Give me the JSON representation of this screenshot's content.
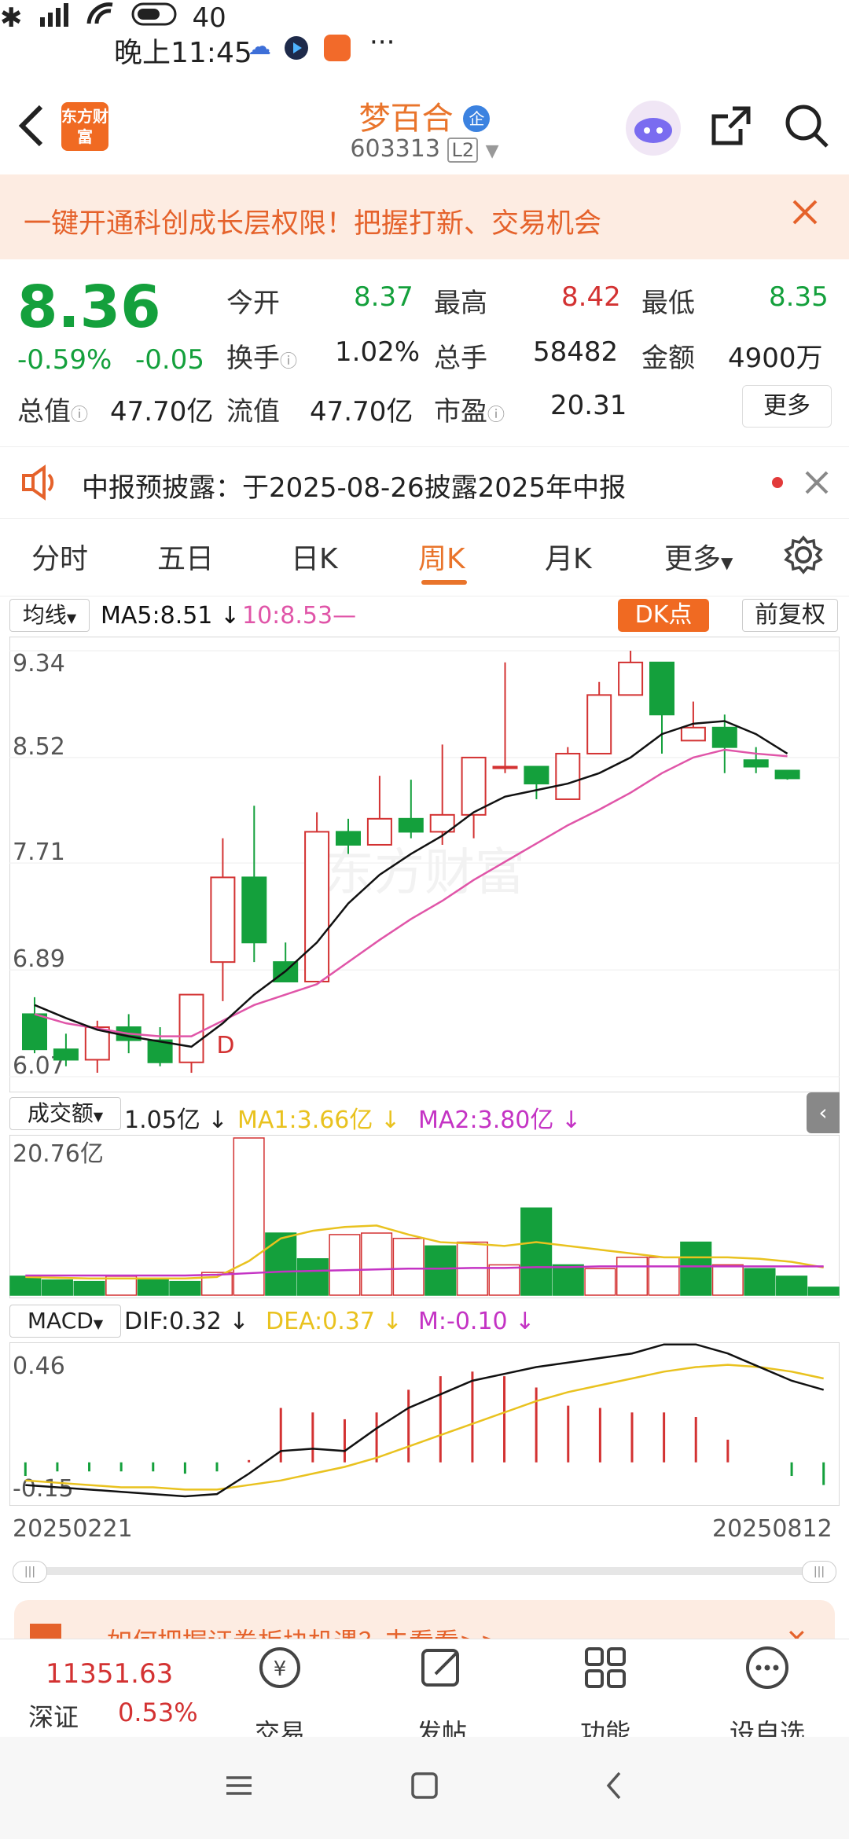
{
  "status_bar": {
    "time": "晚上11:45",
    "extra": "···",
    "battery": "40"
  },
  "header": {
    "logo_text": "东方财富",
    "title": "梦百合",
    "badge": "企",
    "code": "603313",
    "level": "L2"
  },
  "banner": {
    "text": "一键开通科创成长层权限！把握打新、交易机会"
  },
  "quote": {
    "price": "8.36",
    "change_pct": "-0.59%",
    "change": "-0.05",
    "rows": [
      [
        {
          "label": "今开",
          "value": "8.37",
          "color": "green"
        },
        {
          "label": "最高",
          "value": "8.42",
          "color": "red"
        },
        {
          "label": "最低",
          "value": "8.35",
          "color": "green"
        }
      ],
      [
        {
          "label": "换手",
          "value": "1.02%",
          "color": "dark"
        },
        {
          "label": "总手",
          "value": "58482",
          "color": "dark"
        },
        {
          "label": "金额",
          "value": "4900万",
          "color": "dark"
        }
      ],
      [
        {
          "label": "总值",
          "value": "47.70亿",
          "color": "dark"
        },
        {
          "label": "流值",
          "value": "47.70亿",
          "color": "dark"
        },
        {
          "label": "市盈",
          "value": "20.31",
          "color": "dark"
        }
      ]
    ],
    "more_label": "更多"
  },
  "notice": {
    "text": "中报预披露：于2025-08-26披露2025年中报"
  },
  "tabs": [
    "分时",
    "五日",
    "日K",
    "周K",
    "月K",
    "更多"
  ],
  "active_tab": "周K",
  "kline": {
    "ma_selector": "均线",
    "ma5_label": "MA5:8.51",
    "ma10_label": "10:8.53",
    "dk_label": "DK点",
    "adjust_label": "前复权",
    "y_ticks": [
      "9.34",
      "8.52",
      "7.71",
      "6.89",
      "6.07"
    ],
    "d_marker": "D",
    "watermark": "东方财富"
  },
  "volume": {
    "selector": "成交额",
    "current": "1.05亿",
    "ma1_label": "MA1:3.66亿",
    "ma2_label": "MA2:3.80亿",
    "max_label": "20.76亿"
  },
  "macd": {
    "selector": "MACD",
    "dif_label": "DIF:0.32",
    "dea_label": "DEA:0.37",
    "m_label": "M:-0.10",
    "top_tick": "0.46",
    "bottom_tick": "-0.15"
  },
  "x_axis": {
    "start": "20250221",
    "end": "20250812"
  },
  "promo": {
    "text": "如何把握证券板块机遇？去看看>>"
  },
  "bottom_nav": {
    "index_value": "11351.63",
    "index_name": "深证",
    "index_change": "0.53%",
    "items": [
      "交易",
      "发帖",
      "功能",
      "设自选"
    ]
  },
  "colors": {
    "up": "#d33232",
    "down": "#14a03c",
    "accent": "#e9742b",
    "ma5": "#111111",
    "ma10": "#e055a8",
    "ma1": "#e9c21f",
    "ma2": "#c433c4"
  },
  "chart_data": {
    "type": "candlestick",
    "period": "weekly",
    "x_start": "20250221",
    "x_end": "20250812",
    "ylim": [
      6.07,
      9.34
    ],
    "candles": [
      {
        "o": 6.55,
        "h": 6.68,
        "l": 6.25,
        "c": 6.28
      },
      {
        "o": 6.28,
        "h": 6.4,
        "l": 6.15,
        "c": 6.2
      },
      {
        "o": 6.2,
        "h": 6.5,
        "l": 6.1,
        "c": 6.45
      },
      {
        "o": 6.45,
        "h": 6.55,
        "l": 6.25,
        "c": 6.35
      },
      {
        "o": 6.35,
        "h": 6.45,
        "l": 6.15,
        "c": 6.18
      },
      {
        "o": 6.18,
        "h": 6.7,
        "l": 6.1,
        "c": 6.7
      },
      {
        "o": 6.95,
        "h": 7.9,
        "l": 6.65,
        "c": 7.6
      },
      {
        "o": 7.6,
        "h": 8.15,
        "l": 6.95,
        "c": 7.1
      },
      {
        "o": 6.95,
        "h": 7.1,
        "l": 6.8,
        "c": 6.8
      },
      {
        "o": 6.8,
        "h": 8.1,
        "l": 6.8,
        "c": 7.95
      },
      {
        "o": 7.95,
        "h": 8.05,
        "l": 7.78,
        "c": 7.85
      },
      {
        "o": 7.85,
        "h": 8.38,
        "l": 7.85,
        "c": 8.05
      },
      {
        "o": 8.05,
        "h": 8.35,
        "l": 7.9,
        "c": 7.95
      },
      {
        "o": 7.95,
        "h": 8.62,
        "l": 7.85,
        "c": 8.08
      },
      {
        "o": 8.08,
        "h": 8.5,
        "l": 7.9,
        "c": 8.52
      },
      {
        "o": 8.45,
        "h": 9.25,
        "l": 8.4,
        "c": 8.45
      },
      {
        "o": 8.45,
        "h": 8.45,
        "l": 8.2,
        "c": 8.32
      },
      {
        "o": 8.2,
        "h": 8.6,
        "l": 8.2,
        "c": 8.55
      },
      {
        "o": 8.55,
        "h": 9.1,
        "l": 8.55,
        "c": 9.0
      },
      {
        "o": 9.0,
        "h": 9.34,
        "l": 9.0,
        "c": 9.25
      },
      {
        "o": 9.25,
        "h": 9.25,
        "l": 8.55,
        "c": 8.85
      },
      {
        "o": 8.65,
        "h": 8.95,
        "l": 8.65,
        "c": 8.75
      },
      {
        "o": 8.75,
        "h": 8.85,
        "l": 8.4,
        "c": 8.6
      },
      {
        "o": 8.5,
        "h": 8.6,
        "l": 8.4,
        "c": 8.45
      },
      {
        "o": 8.42,
        "h": 8.42,
        "l": 8.35,
        "c": 8.36
      }
    ],
    "ma5": [
      6.62,
      6.52,
      6.43,
      6.38,
      6.34,
      6.3,
      6.48,
      6.7,
      6.88,
      7.1,
      7.4,
      7.62,
      7.78,
      7.92,
      8.1,
      8.22,
      8.27,
      8.32,
      8.4,
      8.52,
      8.7,
      8.78,
      8.8,
      8.7,
      8.55
    ],
    "ma10": [
      6.55,
      6.48,
      6.44,
      6.4,
      6.38,
      6.38,
      6.5,
      6.62,
      6.7,
      6.78,
      6.95,
      7.12,
      7.28,
      7.42,
      7.58,
      7.72,
      7.86,
      8.0,
      8.12,
      8.25,
      8.4,
      8.52,
      8.58,
      8.55,
      8.53
    ],
    "volume": {
      "unit": "亿",
      "max": 20.76,
      "values": [
        2.5,
        2.0,
        1.8,
        2.5,
        2.0,
        1.8,
        3.0,
        20.76,
        8.2,
        4.8,
        8.0,
        8.2,
        7.5,
        6.5,
        7.0,
        4.0,
        11.5,
        4.0,
        3.5,
        5.0,
        5.0,
        7.0,
        4.0,
        3.5,
        2.5,
        1.05
      ],
      "up": [
        false,
        false,
        false,
        true,
        false,
        false,
        true,
        true,
        false,
        false,
        true,
        true,
        true,
        false,
        true,
        true,
        false,
        false,
        true,
        true,
        true,
        false,
        true,
        false,
        false,
        false
      ],
      "ma1": [
        2.4,
        2.3,
        2.2,
        2.2,
        2.2,
        2.2,
        2.4,
        4.5,
        7.5,
        8.5,
        9.0,
        9.2,
        8.0,
        7.0,
        6.8,
        6.5,
        7.0,
        6.5,
        6.0,
        5.5,
        5.0,
        5.0,
        5.0,
        4.8,
        4.4,
        3.66
      ],
      "ma2": [
        2.6,
        2.6,
        2.6,
        2.6,
        2.6,
        2.6,
        2.7,
        2.9,
        3.1,
        3.2,
        3.3,
        3.4,
        3.5,
        3.5,
        3.6,
        3.6,
        3.7,
        3.7,
        3.8,
        3.8,
        3.8,
        3.8,
        3.8,
        3.8,
        3.8,
        3.8
      ]
    },
    "macd": {
      "ylim": [
        -0.15,
        0.46
      ],
      "dif": [
        -0.1,
        -0.11,
        -0.12,
        -0.13,
        -0.14,
        -0.15,
        -0.14,
        -0.05,
        0.05,
        0.06,
        0.05,
        0.15,
        0.24,
        0.3,
        0.36,
        0.39,
        0.42,
        0.44,
        0.46,
        0.48,
        0.52,
        0.52,
        0.48,
        0.42,
        0.36,
        0.32
      ],
      "dea": [
        -0.08,
        -0.09,
        -0.1,
        -0.11,
        -0.11,
        -0.12,
        -0.12,
        -0.1,
        -0.08,
        -0.05,
        -0.02,
        0.02,
        0.07,
        0.12,
        0.17,
        0.22,
        0.27,
        0.31,
        0.34,
        0.37,
        0.4,
        0.42,
        0.43,
        0.42,
        0.4,
        0.37
      ],
      "m": [
        -0.06,
        -0.04,
        -0.04,
        -0.04,
        -0.04,
        -0.05,
        -0.04,
        0.01,
        0.24,
        0.22,
        0.19,
        0.22,
        0.32,
        0.38,
        0.4,
        0.38,
        0.33,
        0.25,
        0.24,
        0.22,
        0.22,
        0.2,
        0.1,
        0.0,
        -0.06,
        -0.1
      ]
    }
  }
}
